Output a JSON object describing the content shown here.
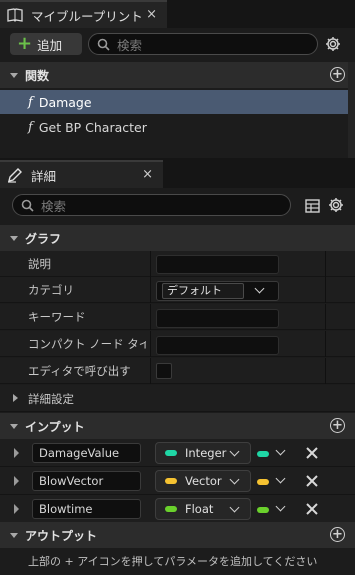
{
  "blueprint_tab": {
    "title": "マイブループリント",
    "close": "×"
  },
  "blueprint_toolbar": {
    "add_label": "追加",
    "search_placeholder": "検索"
  },
  "functions_section": {
    "title": "関数",
    "items": [
      {
        "name": "Damage",
        "selected": true
      },
      {
        "name": "Get BP Character",
        "selected": false
      }
    ]
  },
  "details_tab": {
    "title": "詳細",
    "close": "×"
  },
  "details_toolbar": {
    "search_placeholder": "検索"
  },
  "graph_section": {
    "title": "グラフ",
    "fields": {
      "description": "説明",
      "category": "カテゴリ",
      "category_value": "デフォルト",
      "keywords": "キーワード",
      "compact_node_title": "コンパクト ノード タイトル",
      "call_in_editor": "エディタで呼び出す"
    },
    "advanced": "詳細設定"
  },
  "inputs_section": {
    "title": "インプット",
    "params": [
      {
        "name": "DamageValue",
        "type": "Integer",
        "color": "#1fd6a5"
      },
      {
        "name": "BlowVector",
        "type": "Vector",
        "color": "#f5c231"
      },
      {
        "name": "Blowtime",
        "type": "Float",
        "color": "#6ad12c"
      }
    ]
  },
  "outputs_section": {
    "title": "アウトプット",
    "hint": "上部の + アイコンを押してパラメータを追加してください"
  },
  "icon_color_add": "#6bc14a"
}
